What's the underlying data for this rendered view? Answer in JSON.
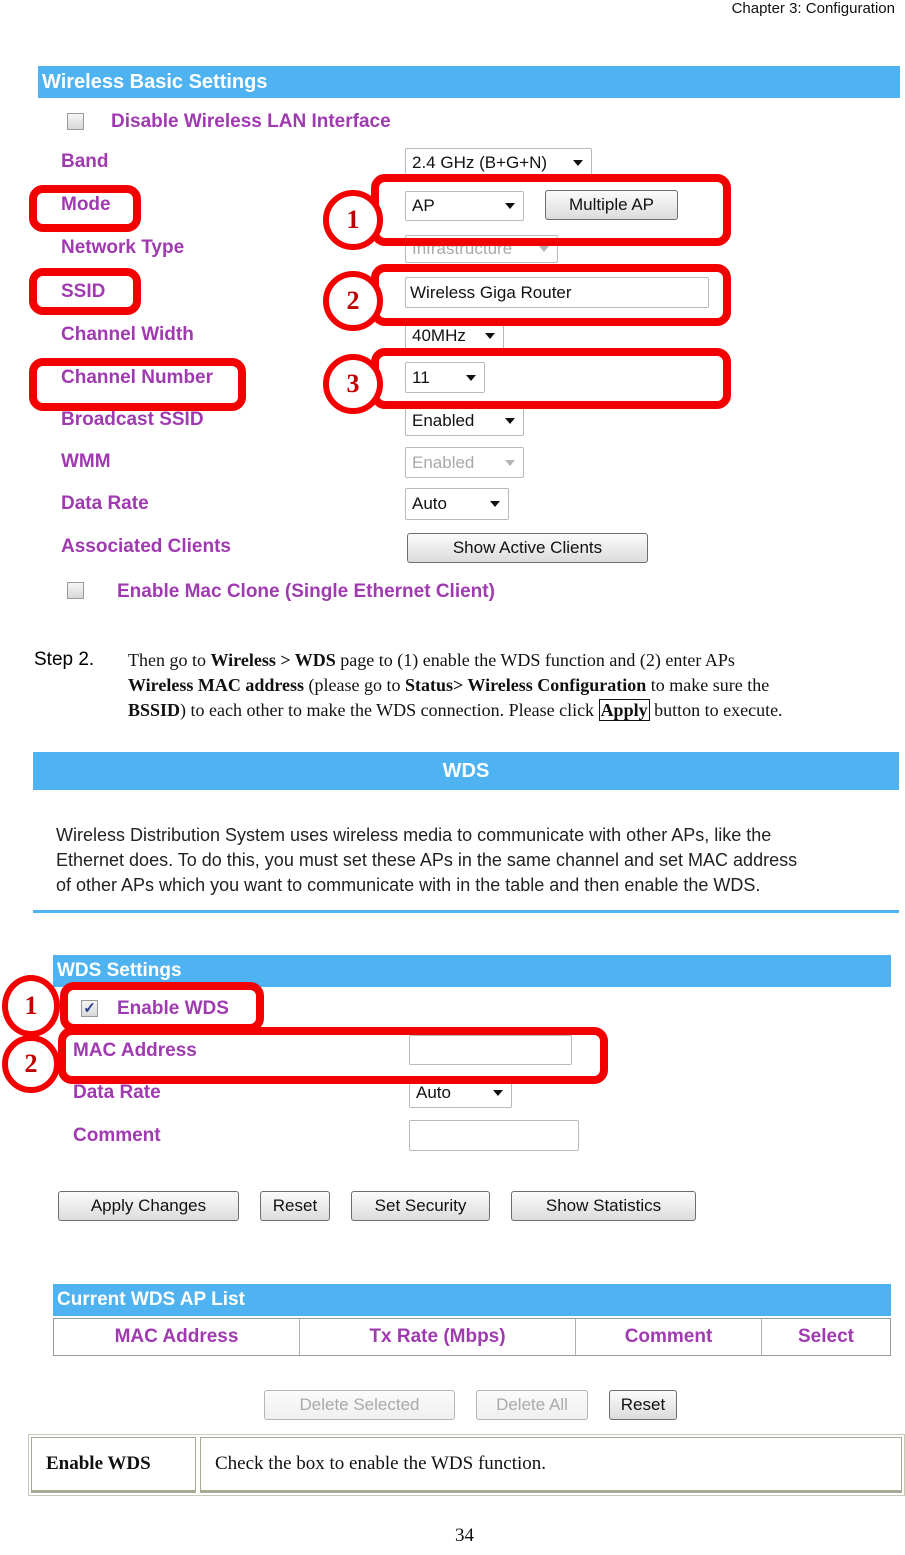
{
  "header": {
    "chapter": "Chapter 3: Configuration"
  },
  "wireless_basic": {
    "title": "Wireless Basic Settings",
    "disable_wlan": {
      "label": "Disable Wireless LAN Interface",
      "checked": false
    },
    "rows": [
      {
        "label": "Band",
        "value": "2.4 GHz (B+G+N)"
      },
      {
        "label": "Mode",
        "value": "AP",
        "button": "Multiple AP"
      },
      {
        "label": "Network Type",
        "value": "Infrastructure"
      },
      {
        "label": "SSID",
        "value": "Wireless Giga Router"
      },
      {
        "label": "Channel Width",
        "value": "40MHz"
      },
      {
        "label": "Channel Number",
        "value": "11"
      },
      {
        "label": "Broadcast SSID",
        "value": "Enabled"
      },
      {
        "label": "WMM",
        "value": "Enabled"
      },
      {
        "label": "Data Rate",
        "value": "Auto"
      },
      {
        "label": "Associated Clients",
        "button": "Show Active Clients"
      }
    ],
    "mac_clone": {
      "label": "Enable Mac Clone (Single Ethernet Client)",
      "checked": false
    },
    "callouts": [
      "1",
      "2",
      "3"
    ]
  },
  "step2": {
    "label": "Step 2.",
    "line1": [
      {
        "t": "Then go to ",
        "b": false
      },
      {
        "t": "Wireless > WDS",
        "b": true
      },
      {
        "t": " page to (1) enable the WDS function and (2) enter APs",
        "b": false
      }
    ],
    "line2": [
      {
        "t": "Wireless MAC address",
        "b": true
      },
      {
        "t": " (please go to ",
        "b": false
      },
      {
        "t": "Status> Wireless  Configuration",
        "b": true
      },
      {
        "t": " to make sure the",
        "b": false
      }
    ],
    "line3_a": "BSSID",
    "line3_b": ") to each other to make the WDS connection. Please click ",
    "line3_apply": "Apply",
    "line3_c": " button to execute."
  },
  "wds": {
    "title": "WDS",
    "description": [
      "Wireless Distribution System uses wireless media to communicate with other APs, like the",
      "Ethernet does. To do this, you must set these APs in the same channel and set MAC address",
      "of other APs which you want to communicate with in the table and then enable the WDS."
    ],
    "settings_title": "WDS Settings",
    "enable_wds": {
      "label": "Enable WDS",
      "checked": true
    },
    "mac_address": {
      "label": "MAC Address",
      "value": ""
    },
    "data_rate": {
      "label": "Data Rate",
      "value": "Auto"
    },
    "comment": {
      "label": "Comment",
      "value": ""
    },
    "buttons": {
      "apply": "Apply Changes",
      "reset": "Reset",
      "security": "Set Security",
      "statistics": "Show Statistics"
    },
    "callouts": [
      "1",
      "2"
    ],
    "ap_list": {
      "title": "Current WDS AP List",
      "columns": [
        "MAC Address",
        "Tx Rate (Mbps)",
        "Comment",
        "Select"
      ],
      "rows": []
    },
    "list_buttons": {
      "delete_selected": "Delete Selected",
      "delete_all": "Delete All",
      "reset": "Reset"
    }
  },
  "definition": {
    "term": "Enable WDS",
    "text": "Check the box to enable the WDS function."
  },
  "footer": {
    "page": "34"
  }
}
